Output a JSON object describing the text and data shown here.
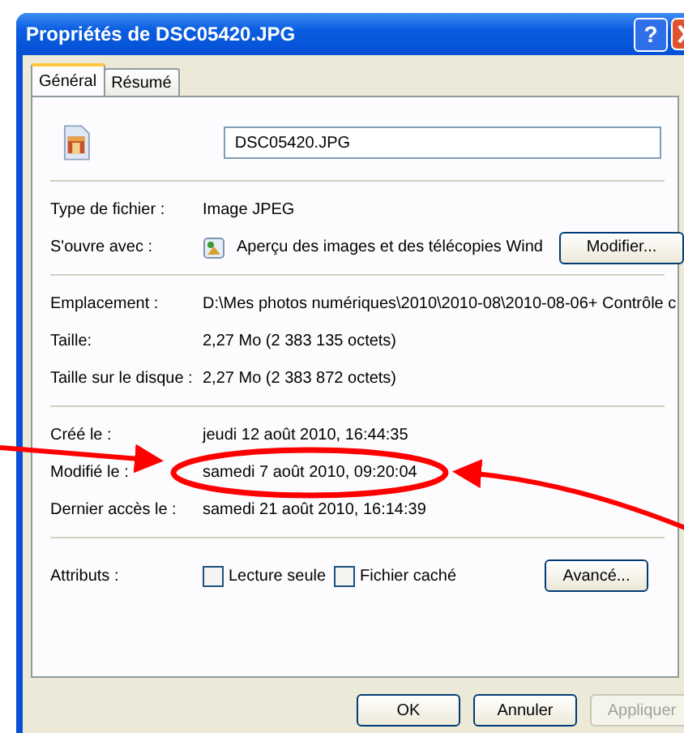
{
  "window": {
    "title": "Propriétés de DSC05420.JPG",
    "help_button": "?"
  },
  "tabs": [
    {
      "label": "Général",
      "selected": true
    },
    {
      "label": "Résumé",
      "selected": false
    }
  ],
  "file_name": "DSC05420.JPG",
  "sections": [
    {
      "rows": [
        {
          "label": "Type de fichier :",
          "value": "Image JPEG"
        },
        {
          "label": "S'ouvre avec :",
          "value": "Aperçu des images et des télécopies Wind",
          "button": "Modifier..."
        }
      ]
    },
    {
      "rows": [
        {
          "label": "Emplacement :",
          "value": "D:\\Mes photos numériques\\2010\\2010-08\\2010-08-06+ Contrôle c"
        },
        {
          "label": "Taille:",
          "value": "2,27 Mo (2 383 135 octets)"
        },
        {
          "label": "Taille sur le disque :",
          "value": "2,27 Mo (2 383 872 octets)"
        }
      ]
    },
    {
      "rows": [
        {
          "label": "Créé le :",
          "value": "jeudi 12 août 2010, 16:44:35"
        },
        {
          "label": "Modifié le :",
          "value": "samedi 7 août 2010, 09:20:04"
        },
        {
          "label": "Dernier accès le :",
          "value": "samedi 21 août 2010, 16:14:39"
        }
      ]
    }
  ],
  "attributes": {
    "label": "Attributs :",
    "checkboxes": [
      {
        "label": "Lecture seule",
        "checked": false
      },
      {
        "label": "Fichier caché",
        "checked": false
      }
    ],
    "button": "Avancé..."
  },
  "buttons": [
    {
      "label": "OK",
      "disabled": false
    },
    {
      "label": "Annuler",
      "disabled": false
    },
    {
      "label": "Appliquer",
      "disabled": true
    }
  ],
  "annotations": [
    {
      "kind": "ellipse"
    },
    {
      "kind": "arrow"
    },
    {
      "kind": "curved-arrow"
    }
  ]
}
